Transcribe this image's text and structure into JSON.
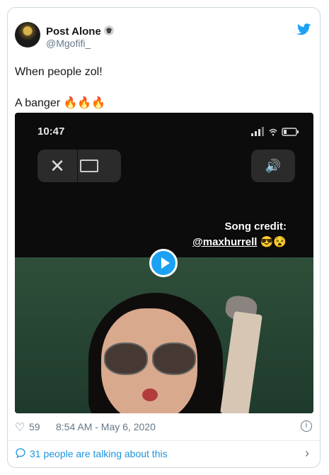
{
  "author": {
    "name": "Post Alone",
    "handle": "@Mgofifi_"
  },
  "tweet": {
    "line1": "When people zol!",
    "line2": "A banger 🔥🔥🔥"
  },
  "video": {
    "status_time": "10:47",
    "credit_line1": "Song credit:",
    "credit_line2": "@maxhurrell",
    "credit_emojis": "😎😵"
  },
  "meta": {
    "likes": "59",
    "timestamp": "8:54 AM - May 6, 2020"
  },
  "footer": {
    "talking": "31 people are talking about this"
  },
  "colors": {
    "accent": "#1da1f2",
    "link": "#1b95e0",
    "muted": "#657786"
  }
}
